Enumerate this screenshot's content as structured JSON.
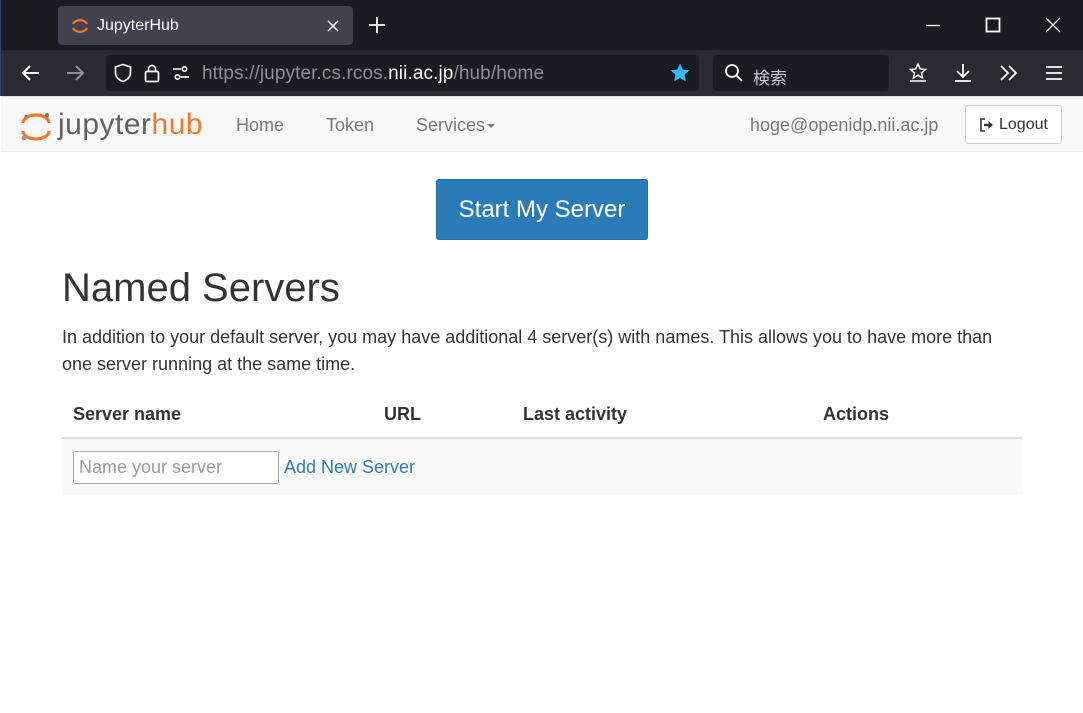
{
  "browser": {
    "tab_title": "JupyterHub",
    "url_prefix": "https://jupyter.cs.rcos.",
    "url_host": "nii.ac.jp",
    "url_path": "/hub/home",
    "search_placeholder": "検索",
    "accent_star": "#2ec1ff"
  },
  "hub": {
    "logo_jupyter": "jupyter",
    "logo_hub": "hub",
    "nav": {
      "home": "Home",
      "token": "Token",
      "services": "Services"
    },
    "user_email": "hoge@openidp.nii.ac.jp",
    "logout_label": "Logout",
    "brand_color": "#f37726",
    "primary_color": "#2b7bb9"
  },
  "main": {
    "start_button": "Start My Server",
    "title": "Named Servers",
    "description": "In addition to your default server, you may have additional 4 server(s) with names. This allows you to have more than one server running at the same time.",
    "table": {
      "headers": [
        "Server name",
        "URL",
        "Last activity",
        "Actions"
      ],
      "name_placeholder": "Name your server",
      "add_label": "Add New Server"
    }
  }
}
